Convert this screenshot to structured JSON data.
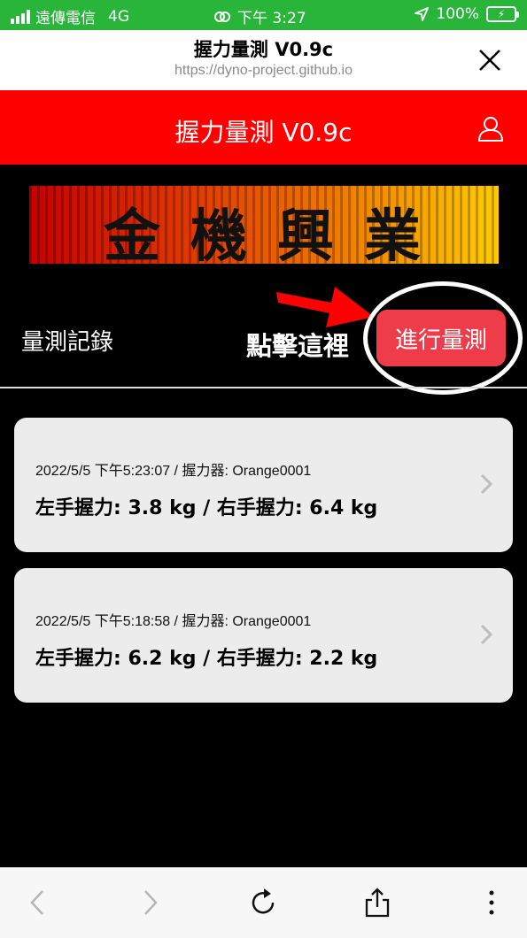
{
  "status": {
    "carrier": "遠傳電信",
    "network": "4G",
    "time": "下午 3:27",
    "battery": "100%"
  },
  "browser": {
    "title": "握力量測 V0.9c",
    "url": "https://dyno-project.github.io"
  },
  "app": {
    "title": "握力量測 V0.9c",
    "banner_text": "金機興業"
  },
  "actions": {
    "records_label": "量測記錄",
    "hint": "點擊這裡",
    "measure_button": "進行量測"
  },
  "records": [
    {
      "meta": "2022/5/5 下午5:23:07 / 握力器: Orange0001",
      "value": "左手握力: 3.8 kg / 右手握力: 6.4 kg"
    },
    {
      "meta": "2022/5/5 下午5:18:58 / 握力器: Orange0001",
      "value": "左手握力: 6.2 kg / 右手握力: 2.2 kg"
    }
  ],
  "toolbar": {
    "icons": [
      "back-icon",
      "forward-icon",
      "reload-icon",
      "share-icon",
      "more-icon"
    ]
  },
  "colors": {
    "status_green": "#28b53a",
    "header_red": "#ff0000",
    "button_red": "#ee3c4a",
    "card_gray": "#ececec"
  }
}
